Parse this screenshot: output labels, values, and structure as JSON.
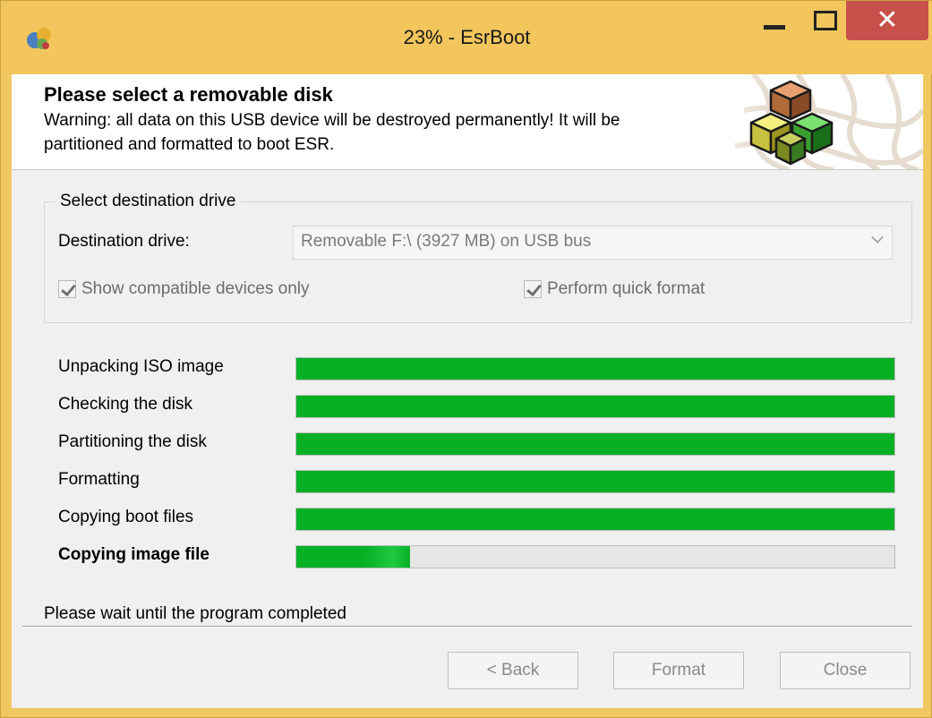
{
  "window": {
    "title": "23% - EsrBoot",
    "close_glyph": "✕"
  },
  "header": {
    "title": "Please select a removable disk",
    "warning": "Warning: all data on this USB device will be destroyed permanently! It will be partitioned and formatted to boot ESR."
  },
  "destination": {
    "group_label": "Select destination drive",
    "drive_label": "Destination drive:",
    "drive_value": "Removable  F:\\  (3927 MB)  on USB bus",
    "show_compatible_label": "Show compatible devices only",
    "show_compatible_checked": true,
    "quick_format_label": "Perform quick format",
    "quick_format_checked": true
  },
  "progress": {
    "steps": [
      {
        "label": "Unpacking ISO image",
        "progress": 1.0,
        "active": false
      },
      {
        "label": "Checking the disk",
        "progress": 1.0,
        "active": false
      },
      {
        "label": "Partitioning the disk",
        "progress": 1.0,
        "active": false
      },
      {
        "label": "Formatting",
        "progress": 1.0,
        "active": false
      },
      {
        "label": "Copying boot files",
        "progress": 1.0,
        "active": false
      },
      {
        "label": "Copying image file",
        "progress": 0.19,
        "active": true
      }
    ]
  },
  "status": {
    "text": "Please wait until the program completed"
  },
  "buttons": {
    "back": "< Back",
    "format": "Format",
    "close": "Close"
  },
  "colors": {
    "title_bar": "#f2c65c",
    "close_button": "#c7504a",
    "progress_green": "#06b025"
  }
}
